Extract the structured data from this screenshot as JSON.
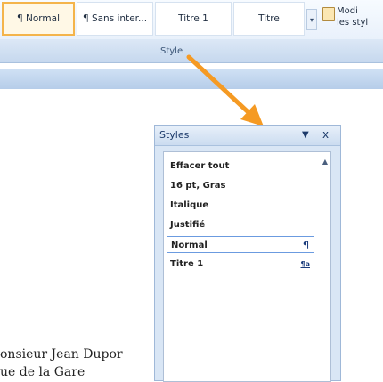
{
  "ribbon": {
    "styles_gallery": [
      {
        "label": "¶ Normal",
        "selected": true
      },
      {
        "label": "¶ Sans inter...",
        "selected": false
      },
      {
        "label": "Titre 1",
        "selected": false
      },
      {
        "label": "Titre",
        "selected": false
      }
    ],
    "modify_label_line1": "Modi",
    "modify_label_line2": "les styl",
    "group_label": "Style",
    "scroll_glyph": "▾"
  },
  "styles_pane": {
    "title": "Styles",
    "dropdown_glyph": "▼",
    "close_glyph": "x",
    "scroll_glyph": "▲",
    "items": [
      {
        "label": "Effacer tout",
        "mark": ""
      },
      {
        "label": "16 pt, Gras",
        "mark": ""
      },
      {
        "label": "Italique",
        "mark": ""
      },
      {
        "label": "Justifié",
        "mark": ""
      },
      {
        "label": "Normal",
        "mark": "¶",
        "selected": true
      },
      {
        "label": "Titre 1",
        "mark": "¶a"
      }
    ]
  },
  "document": {
    "line1": "onsieur Jean Dupor",
    "line2": "ue de la Gare"
  },
  "colors": {
    "arrow": "#f59a23",
    "selection_border": "#6b9be0",
    "ribbon_selected": "#f4b44b"
  }
}
